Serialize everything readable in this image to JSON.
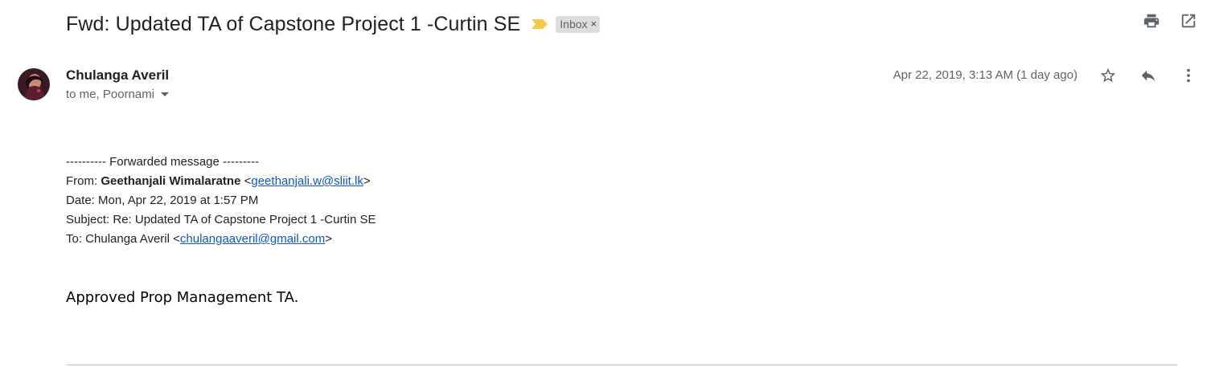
{
  "header": {
    "subject": "Fwd: Updated TA of Capstone Project 1 -Curtin SE",
    "label": "Inbox",
    "label_remove": "×",
    "icons": [
      "print-icon",
      "open-in-new-window-icon"
    ]
  },
  "message": {
    "sender": "Chulanga Averil",
    "recipients": "to me, Poornami",
    "date": "Apr 22, 2019, 3:13 AM (1 day ago)",
    "icons": [
      "star-icon",
      "reply-icon",
      "more-vert-icon"
    ],
    "forwarded": {
      "header": "---------- Forwarded message ---------",
      "from_label": "From: ",
      "from_name": "Geethanjali Wimalaratne",
      "from_email": "geethanjali.w@sliit.lk",
      "date_line": "Date: Mon, Apr 22, 2019 at 1:57 PM",
      "subject_line": "Subject: Re: Updated TA of Capstone Project 1 -Curtin SE",
      "to_label": "To: Chulanga Averil ",
      "to_email": "chulangaaveril@gmail.com"
    },
    "body": "Approved Prop Management TA."
  },
  "colors": {
    "important_marker": "#f2c94c",
    "link": "#1155cc",
    "secondary_text": "#5f6368"
  }
}
